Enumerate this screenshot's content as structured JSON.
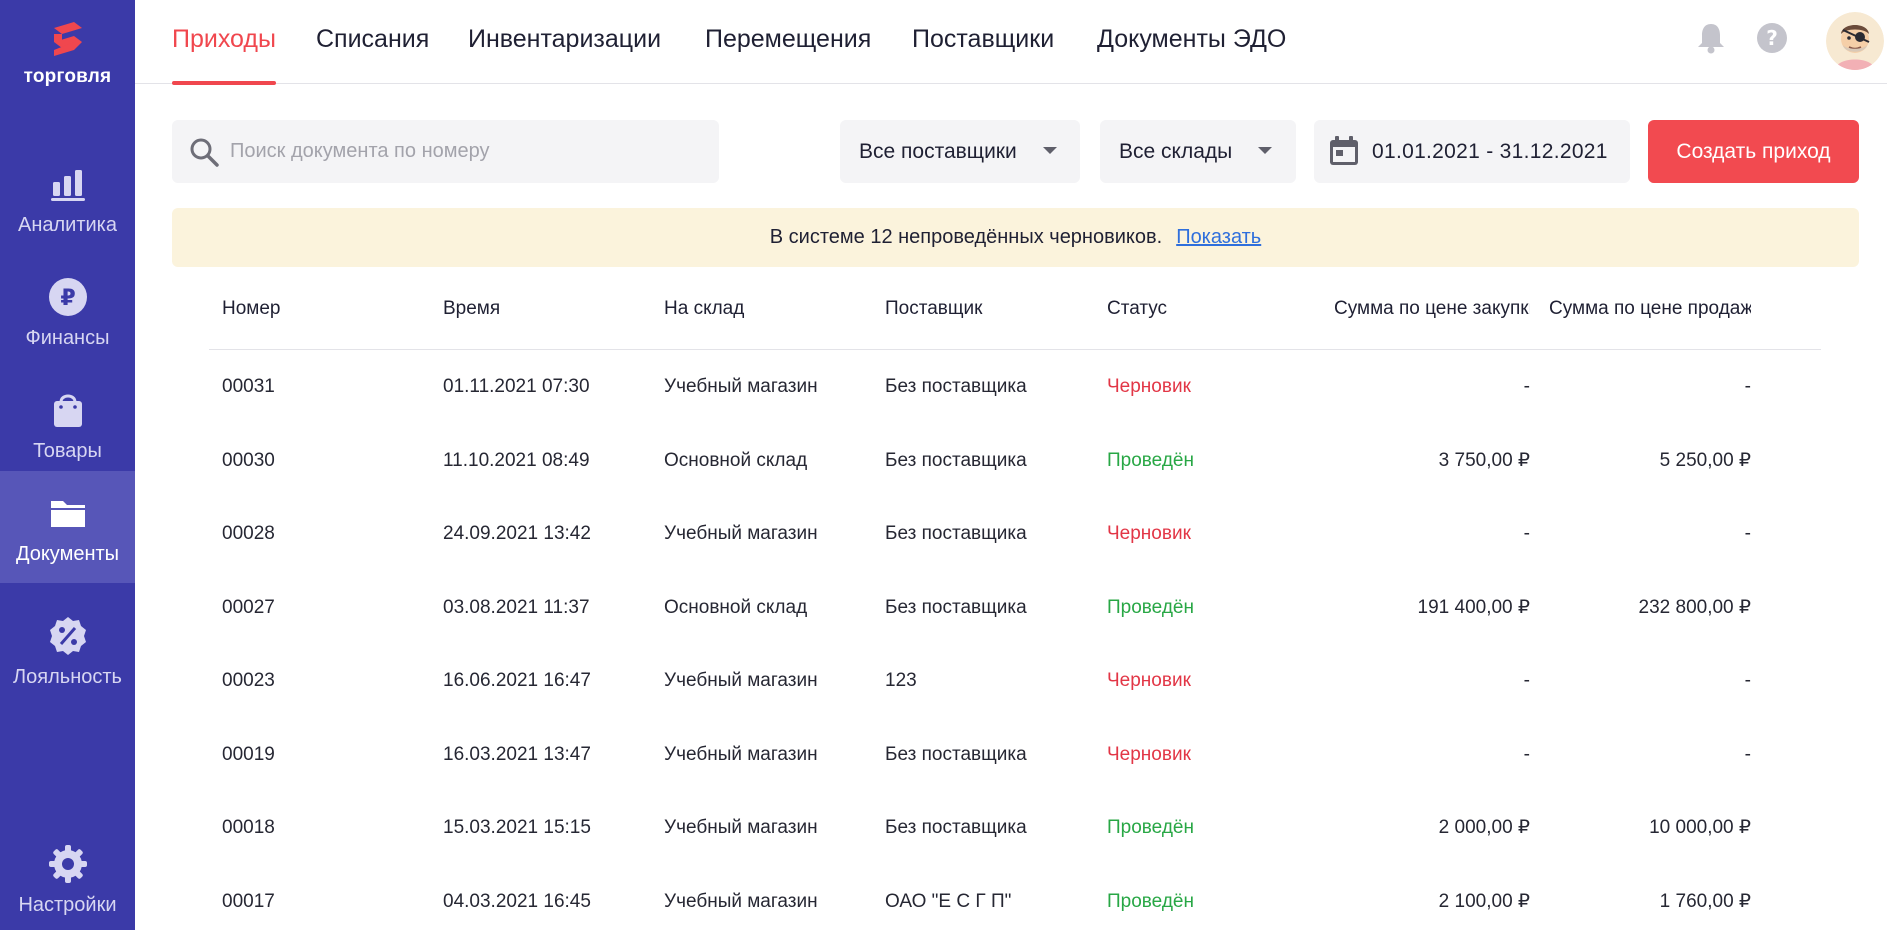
{
  "sidebar": {
    "brand": "торговля",
    "items": [
      {
        "label": "Аналитика",
        "icon": "bar-chart-icon"
      },
      {
        "label": "Финансы",
        "icon": "ruble-icon"
      },
      {
        "label": "Товары",
        "icon": "shopping-bag-icon"
      },
      {
        "label": "Документы",
        "icon": "folder-icon",
        "active": true
      },
      {
        "label": "Лояльность",
        "icon": "discount-badge-icon"
      },
      {
        "label": "Настройки",
        "icon": "gear-icon"
      }
    ]
  },
  "tabs": [
    {
      "label": "Приходы",
      "active": true
    },
    {
      "label": "Списания"
    },
    {
      "label": "Инвентаризации"
    },
    {
      "label": "Перемещения"
    },
    {
      "label": "Поставщики"
    },
    {
      "label": "Документы ЭДО"
    }
  ],
  "header_icons": [
    "bell-icon",
    "help-icon",
    "user-avatar"
  ],
  "filters": {
    "search_placeholder": "Поиск документа по номеру",
    "supplier": "Все поставщики",
    "warehouse": "Все склады",
    "date_range": "01.01.2021 - 31.12.2021",
    "create_label": "Создать приход"
  },
  "banner": {
    "text": "В системе 12 непроведённых черновиков.",
    "link": "Показать"
  },
  "table": {
    "columns": [
      "Номер",
      "Время",
      "На склад",
      "Поставщик",
      "Статус",
      "Сумма по цене закупки",
      "Сумма по цене продажи"
    ],
    "rows": [
      {
        "number": "00031",
        "time": "01.11.2021 07:30",
        "warehouse": "Учебный магазин",
        "supplier": "Без поставщика",
        "status": "Черновик",
        "status_type": "draft",
        "purchase": "-",
        "sale": "-"
      },
      {
        "number": "00030",
        "time": "11.10.2021 08:49",
        "warehouse": "Основной склад",
        "supplier": "Без поставщика",
        "status": "Проведён",
        "status_type": "posted",
        "purchase": "3 750,00 ₽",
        "sale": "5 250,00 ₽"
      },
      {
        "number": "00028",
        "time": "24.09.2021 13:42",
        "warehouse": "Учебный магазин",
        "supplier": "Без поставщика",
        "status": "Черновик",
        "status_type": "draft",
        "purchase": "-",
        "sale": "-"
      },
      {
        "number": "00027",
        "time": "03.08.2021 11:37",
        "warehouse": "Основной склад",
        "supplier": "Без поставщика",
        "status": "Проведён",
        "status_type": "posted",
        "purchase": "191 400,00 ₽",
        "sale": "232 800,00 ₽"
      },
      {
        "number": "00023",
        "time": "16.06.2021 16:47",
        "warehouse": "Учебный магазин",
        "supplier": "123",
        "status": "Черновик",
        "status_type": "draft",
        "purchase": "-",
        "sale": "-"
      },
      {
        "number": "00019",
        "time": "16.03.2021 13:47",
        "warehouse": "Учебный магазин",
        "supplier": "Без поставщика",
        "status": "Черновик",
        "status_type": "draft",
        "purchase": "-",
        "sale": "-"
      },
      {
        "number": "00018",
        "time": "15.03.2021 15:15",
        "warehouse": "Учебный магазин",
        "supplier": "Без поставщика",
        "status": "Проведён",
        "status_type": "posted",
        "purchase": "2 000,00 ₽",
        "sale": "10 000,00 ₽"
      },
      {
        "number": "00017",
        "time": "04.03.2021 16:45",
        "warehouse": "Учебный магазин",
        "supplier": "ОАО \"Е С Г П\"",
        "status": "Проведён",
        "status_type": "posted",
        "purchase": "2 100,00 ₽",
        "sale": "1 760,00 ₽"
      }
    ]
  },
  "colors": {
    "sidebar": "#3b3aa8",
    "sidebar_active": "#5756b8",
    "accent": "#f0474e",
    "draft": "#e23646",
    "posted": "#28a745",
    "banner_bg": "#fbf3dc",
    "link": "#2f6fdc"
  }
}
